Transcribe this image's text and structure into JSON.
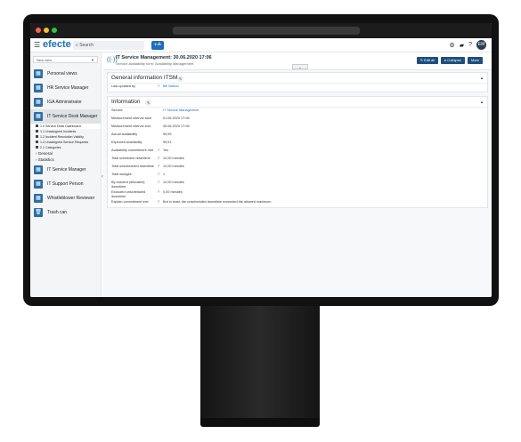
{
  "header": {
    "logo": "efecte",
    "search_placeholder": "Search",
    "plus_label": "+≗",
    "avatar_initials": "EM",
    "icons": [
      "settings-icon",
      "folder-icon",
      "help-icon"
    ]
  },
  "sidebar": {
    "view_select": "New view",
    "items": [
      {
        "label": "Personal views"
      },
      {
        "label": "HR Service Manager"
      },
      {
        "label": "IGA Administrator"
      },
      {
        "label": "IT Service Desk Manager"
      }
    ],
    "subitems": [
      "1.0 Service Desk Dashboard",
      "1.1 Unassigned Incidents",
      "1.2 Incident Resolution Validity",
      "1.3 Unassigned Service Requests",
      "2.1 Categories"
    ],
    "folders": [
      "General",
      "Statistics"
    ],
    "items_after": [
      {
        "label": "IT Service Manager"
      },
      {
        "label": "IT Support Person"
      },
      {
        "label": "Whistleblower Reviewer"
      },
      {
        "label": "Trash can"
      }
    ]
  },
  "titlebar": {
    "title": "IT Service Management: 30.06.2020 17:06",
    "subtitle": "Service availability form: Availability Management",
    "buttons": {
      "edit": "✎ Edit all",
      "collapse": "▸ Collapse",
      "more": "More"
    }
  },
  "panel1": {
    "title": "General information ITSM",
    "last_updated_label": "Last updated by",
    "last_updated_value": "Bill Walton"
  },
  "panel2": {
    "title": "Information",
    "fields": [
      {
        "label": "Service",
        "req": "",
        "value": "IT Service Management",
        "link": true
      },
      {
        "label": "Measurement interval start",
        "req": "",
        "value": "01.06.2020 17:06",
        "link": false
      },
      {
        "label": "Measurement interval end",
        "req": "",
        "value": "30.06.2020 17:06",
        "link": false
      },
      {
        "label": "Actual availability",
        "req": "",
        "value": "99,99",
        "link": false
      },
      {
        "label": "Expected availability",
        "req": "",
        "value": "99,91",
        "link": false
      },
      {
        "label": "Availability commitment met",
        "req": "?",
        "value": "Yes",
        "link": false
      },
      {
        "label": "Total scheduled downtime",
        "req": "?",
        "value": "12,00 minutes",
        "link": false
      },
      {
        "label": "Total unscheduled downtime",
        "req": "?",
        "value": "12,00 minutes",
        "link": false
      },
      {
        "label": "Total outages",
        "req": "?",
        "value": "1",
        "link": false
      },
      {
        "label": "By-incident (allocated) downtime",
        "req": "?",
        "value": "12,00 minutes",
        "link": false
      },
      {
        "label": "Excluded unscheduled downtime",
        "req": "?",
        "value": "0,00 minutes",
        "link": false
      },
      {
        "label": "Explain commitment met",
        "req": "?",
        "value": "But in least, the unscheduled downtime exceeded the allowed maximum",
        "link": false
      }
    ]
  }
}
